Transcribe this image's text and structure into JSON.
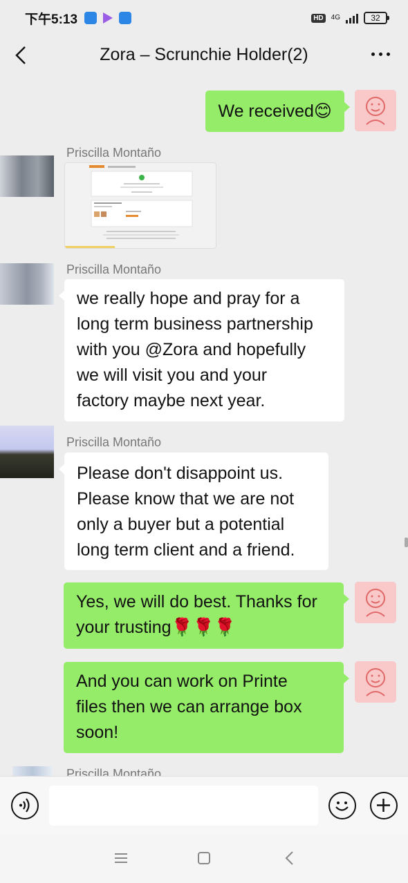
{
  "status_bar": {
    "time": "下午5:13",
    "hd": "HD",
    "network": "4G",
    "battery": "32"
  },
  "header": {
    "title": "Zora – Scrunchie Holder(2)"
  },
  "messages": [
    {
      "side": "right",
      "text": "We received😊"
    },
    {
      "side": "left",
      "sender": "Priscilla Montaño",
      "type": "image"
    },
    {
      "side": "left",
      "sender": "Priscilla Montaño",
      "lines": [
        "we really hope and pray for a",
        "long term business partnership",
        "with you @Zora and hopefully",
        "we will visit you and your",
        "factory maybe next year."
      ]
    },
    {
      "side": "left",
      "sender": "Priscilla Montaño",
      "lines": [
        "Please don't disappoint us.",
        "Please know that we are not",
        "only a buyer but a potential",
        "long term client and a friend."
      ]
    },
    {
      "side": "right",
      "lines": [
        "Yes, we will do best. Thanks for",
        "your trusting🌹🌹🌹"
      ]
    },
    {
      "side": "right",
      "lines": [
        "And you can work on Printe",
        "files then we can arrange box",
        "soon!"
      ]
    },
    {
      "side": "left",
      "sender": "Priscilla Montaño"
    }
  ],
  "colors": {
    "background": "#ededed",
    "self_bubble": "#95ec69",
    "other_bubble": "#ffffff"
  },
  "icons": [
    "back-arrow-icon",
    "more-dots-icon",
    "voice-icon",
    "emoji-icon",
    "plus-icon",
    "menu-icon",
    "home-square-icon",
    "back-triangle-icon"
  ]
}
